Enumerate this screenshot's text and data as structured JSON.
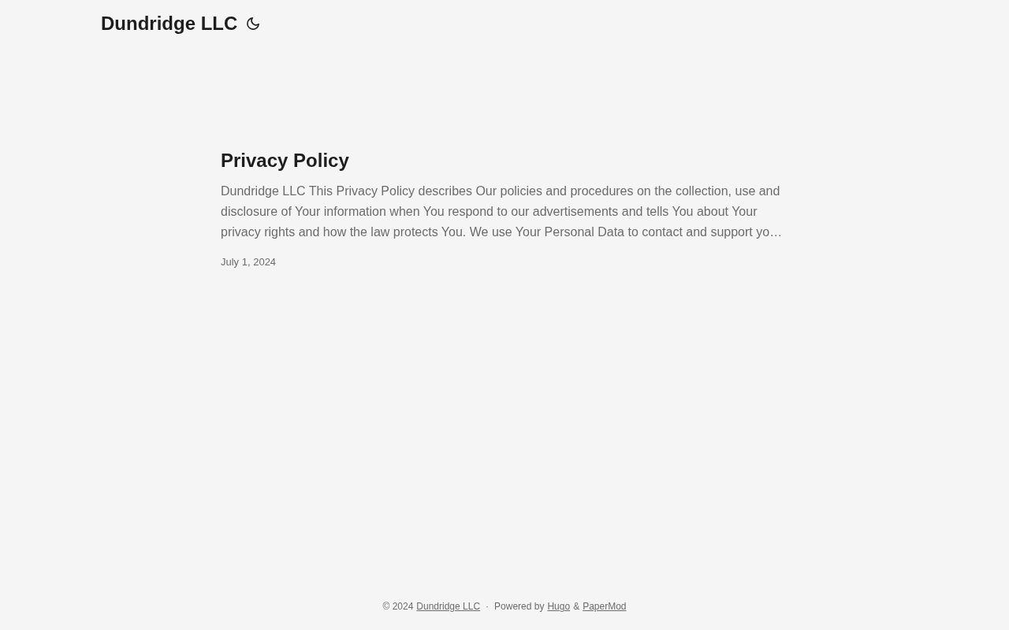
{
  "header": {
    "logo": "Dundridge LLC"
  },
  "posts": [
    {
      "title": "Privacy Policy",
      "summary": "Dundridge LLC This Privacy Policy describes Our policies and procedures on the collection, use and disclosure of Your information when You respond to our advertisements and tells You about Your privacy rights and how the law protects You. We use Your Personal Data to contact and support yo…",
      "date": "July 1, 2024"
    }
  ],
  "footer": {
    "copyright": "© 2024",
    "site_link": "Dundridge LLC",
    "separator": "·",
    "powered_by": "Powered by",
    "links": [
      {
        "kind": "link",
        "text": "Hugo"
      },
      {
        "kind": "text",
        "text": "&"
      },
      {
        "kind": "link",
        "text": "PaperMod"
      }
    ]
  }
}
